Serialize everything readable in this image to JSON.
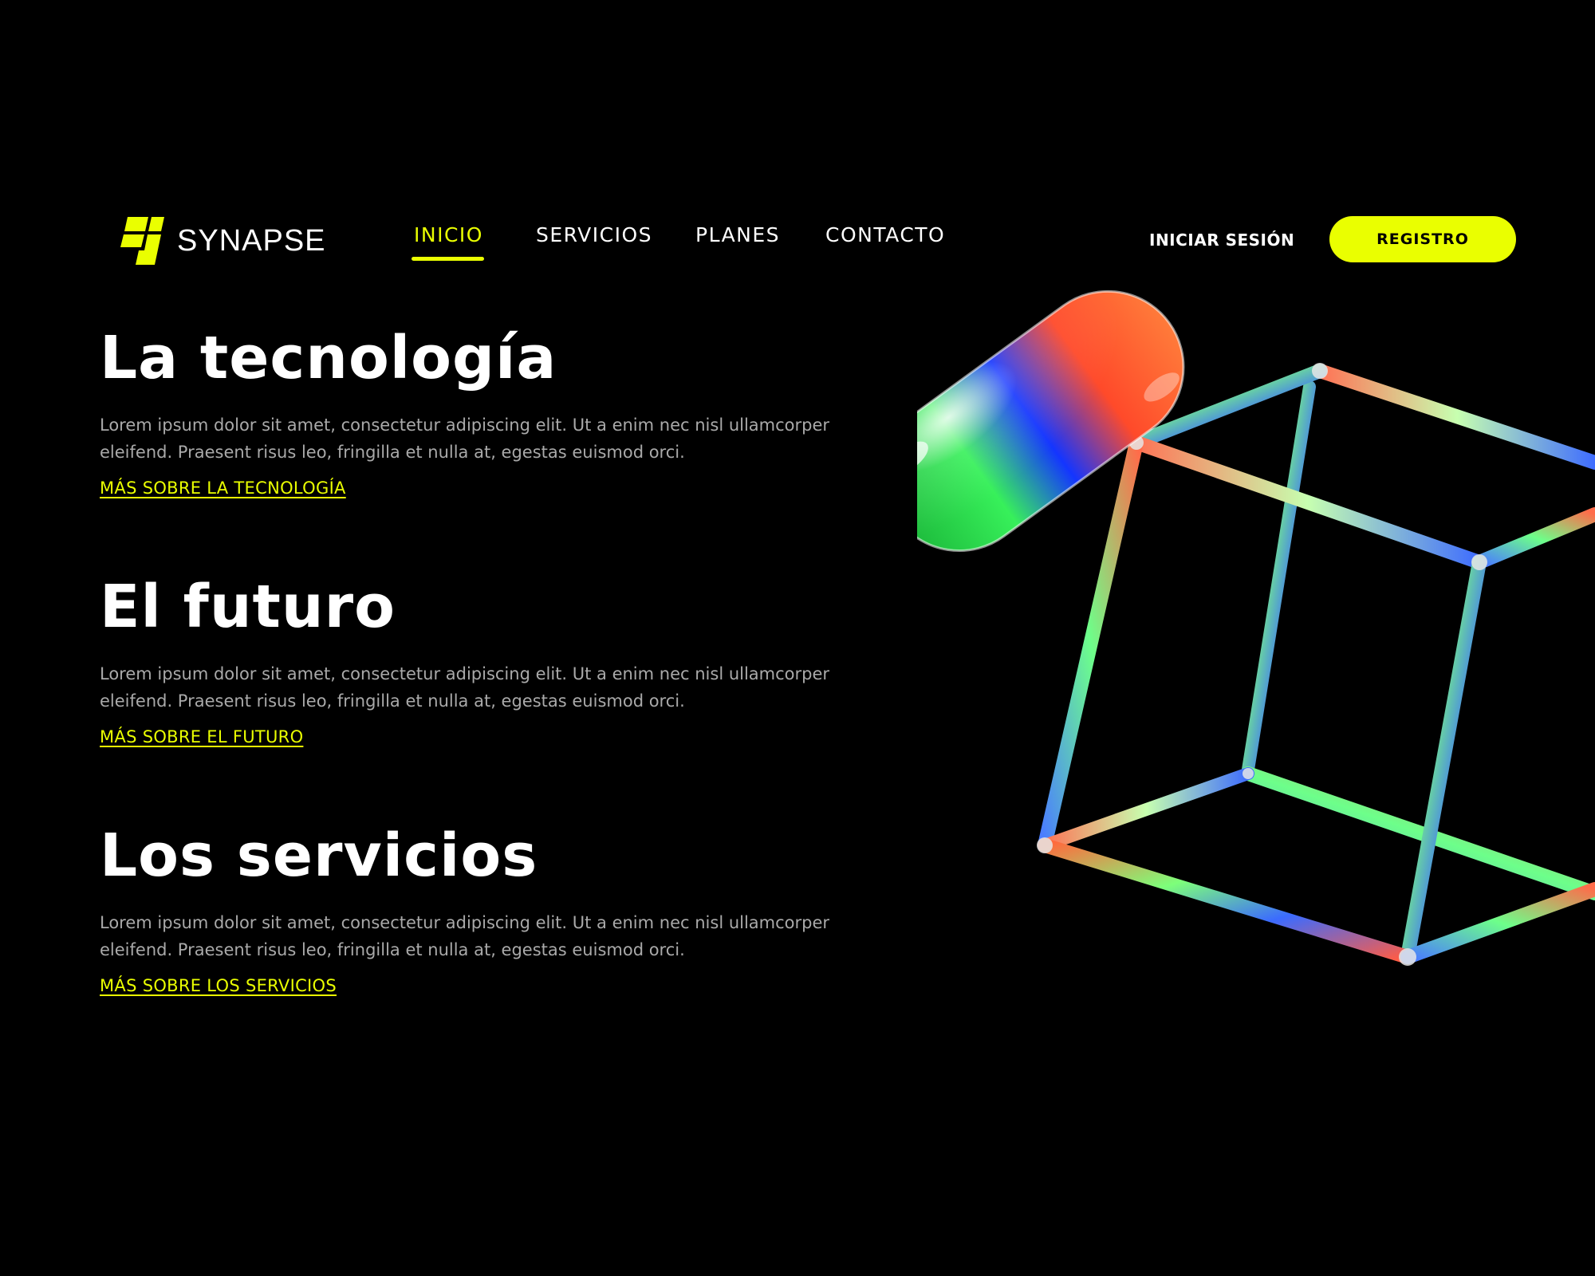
{
  "brand": {
    "name": "SYNAPSE",
    "accent_color": "#eaff00",
    "logo_icon": "synapse-logo-icon"
  },
  "nav": {
    "items": [
      {
        "label": "INICIO",
        "active": true
      },
      {
        "label": "SERVICIOS",
        "active": false
      },
      {
        "label": "PLANES",
        "active": false
      },
      {
        "label": "CONTACTO",
        "active": false
      }
    ],
    "login_label": "INICIAR SESIÓN",
    "register_label": "REGISTRO"
  },
  "sections": [
    {
      "title": "La tecnología",
      "body": "Lorem ipsum dolor sit amet, consectetur adipiscing elit. Ut a enim nec nisl ullamcorper eleifend. Praesent risus leo, fringilla et nulla at, egestas euismod orci.",
      "link": "MÁS SOBRE LA TECNOLOGÍA"
    },
    {
      "title": "El futuro",
      "body": "Lorem ipsum dolor sit amet, consectetur adipiscing elit. Ut a enim nec nisl ullamcorper eleifend. Praesent risus leo, fringilla et nulla at, egestas euismod orci.",
      "link": "MÁS SOBRE EL FUTURO"
    },
    {
      "title": "Los servicios",
      "body": "Lorem ipsum dolor sit amet, consectetur adipiscing elit. Ut a enim nec nisl ullamcorper eleifend. Praesent risus leo, fringilla et nulla at, egestas euismod orci.",
      "link": "MÁS SOBRE LOS SERVICIOS"
    }
  ],
  "colors": {
    "background": "#000000",
    "text": "#ffffff",
    "body_text": "#a9a9a9",
    "accent": "#eaff00"
  }
}
